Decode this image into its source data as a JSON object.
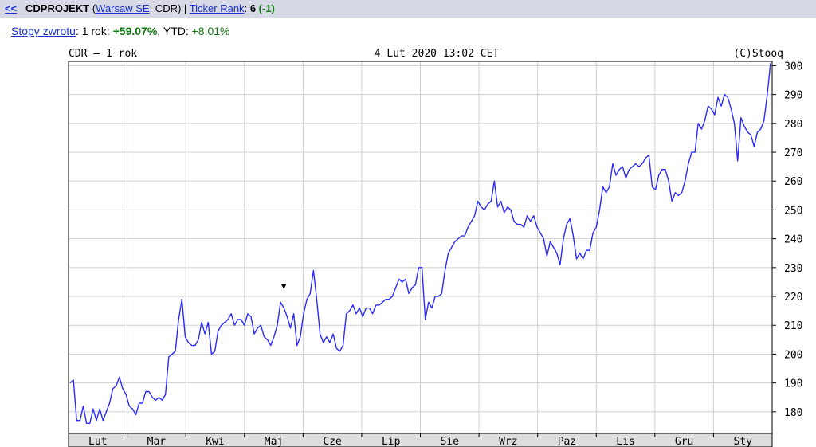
{
  "header": {
    "back_link": "<<",
    "ticker": "CDPROJEKT",
    "paren_open": "(",
    "exchange_link": "Warsaw SE",
    "symbol_text": ": CDR) |",
    "rank_link": "Ticker Rank",
    "rank_colon": ":",
    "rank_value": "6",
    "rank_change": "(-1)"
  },
  "returns": {
    "label_link": "Stopy zwrotu",
    "colon": ":",
    "one_year_label": "1 rok:",
    "one_year_value": "+59.07%",
    "ytd_label": ", YTD:",
    "ytd_value": "+8.01%"
  },
  "chart_data": {
    "type": "line",
    "title": "CDR – 1 rok",
    "subtitle": "4 Lut 2020 13:02 CET",
    "credit": "(C)Stooq",
    "ylim": [
      172.5,
      301.5
    ],
    "yticks": [
      180,
      190,
      200,
      210,
      220,
      230,
      240,
      250,
      260,
      270,
      280,
      290,
      300
    ],
    "y_axis_position": "right",
    "grid": true,
    "months": [
      "Lut",
      "Mar",
      "Kwi",
      "Maj",
      "Cze",
      "Lip",
      "Sie",
      "Wrz",
      "Paz",
      "Lis",
      "Gru",
      "Sty"
    ],
    "marker": {
      "symbol": "▼",
      "index": 65,
      "value": 222
    },
    "series": [
      {
        "color": "#2a2aff",
        "values": [
          190,
          191,
          177,
          177,
          182,
          176,
          176,
          181,
          177,
          181,
          177,
          180,
          183,
          188,
          189,
          192,
          188,
          186,
          182,
          181,
          179,
          183,
          183,
          187,
          187,
          185,
          184,
          185,
          184,
          186,
          199,
          200,
          201,
          212,
          219,
          206,
          204,
          203,
          203,
          205,
          211,
          207,
          211,
          200,
          201,
          208,
          210,
          211,
          212,
          214,
          210,
          212,
          212,
          210,
          214,
          213,
          207,
          209,
          210,
          206,
          205,
          203,
          206,
          210,
          218,
          216,
          213,
          209,
          214,
          203,
          206,
          214,
          219,
          221,
          229,
          219,
          207,
          204,
          206,
          204,
          207,
          202,
          201,
          203,
          214,
          215,
          217,
          214,
          216,
          213,
          216,
          216,
          214,
          217,
          217,
          218,
          219,
          219,
          220,
          223,
          226,
          225,
          226,
          221,
          223,
          224,
          230,
          230,
          212,
          218,
          216,
          220,
          220,
          221,
          229,
          235,
          237,
          239,
          240,
          241,
          241,
          244,
          246,
          248,
          253,
          251,
          250,
          252,
          253,
          260,
          251,
          253,
          249,
          251,
          250,
          246,
          245,
          245,
          244,
          248,
          246,
          248,
          244,
          242,
          240,
          234,
          239,
          237,
          235,
          231,
          240,
          245,
          247,
          241,
          233,
          235,
          233,
          236,
          236,
          242,
          244,
          250,
          258,
          256,
          258,
          266,
          262,
          264,
          265,
          261,
          264,
          265,
          266,
          265,
          266,
          268,
          269,
          258,
          257,
          262,
          264,
          264,
          260,
          253,
          256,
          255,
          256,
          260,
          266,
          270,
          270,
          280,
          278,
          281,
          286,
          285,
          283,
          289,
          286,
          290,
          289,
          285,
          280,
          267,
          282,
          279,
          277,
          276,
          272,
          277,
          278,
          281,
          290,
          301
        ]
      }
    ]
  }
}
